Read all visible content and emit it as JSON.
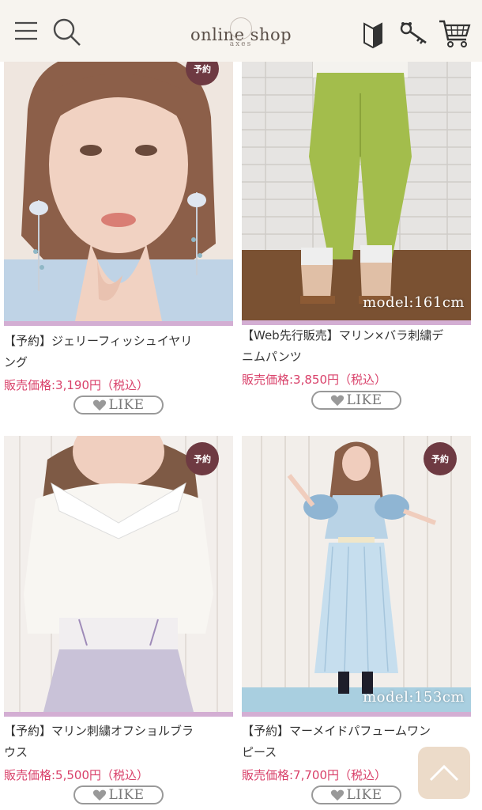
{
  "header": {
    "logo_text": "online shop",
    "logo_sub": "axes",
    "icons": [
      "menu-icon",
      "search-icon",
      "beginner-mark-icon",
      "key-icon",
      "cart-icon"
    ]
  },
  "products": [
    {
      "badge": "予約",
      "name_line1": "【予約】ジェリーフィッシュイヤリ",
      "name_line2": "ング",
      "price": "販売価格:3,190円（税込）",
      "like": "LIKE",
      "model": ""
    },
    {
      "badge": "",
      "name_line1": "【Web先行販売】マリン×バラ刺繍デ",
      "name_line2": "ニムパンツ",
      "price": "販売価格:3,850円（税込）",
      "like": "LIKE",
      "model": "model:161cm"
    },
    {
      "badge": "予約",
      "name_line1": "【予約】マリン刺繍オフショルブラ",
      "name_line2": "ウス",
      "price": "販売価格:5,500円（税込）",
      "like": "LIKE",
      "model": ""
    },
    {
      "badge": "予約",
      "name_line1": "【予約】マーメイドパフュームワン",
      "name_line2": "ピース",
      "price": "販売価格:7,700円（税込）",
      "like": "LIKE",
      "model": "model:153cm"
    }
  ],
  "colors": {
    "header_bg": "#f7f4ef",
    "badge": "#6e3a42",
    "price": "#d9416a",
    "image_underline": "#d3aed3",
    "back_to_top": "#ecdbc9"
  },
  "back_to_top_icon": "chevron-up-icon"
}
